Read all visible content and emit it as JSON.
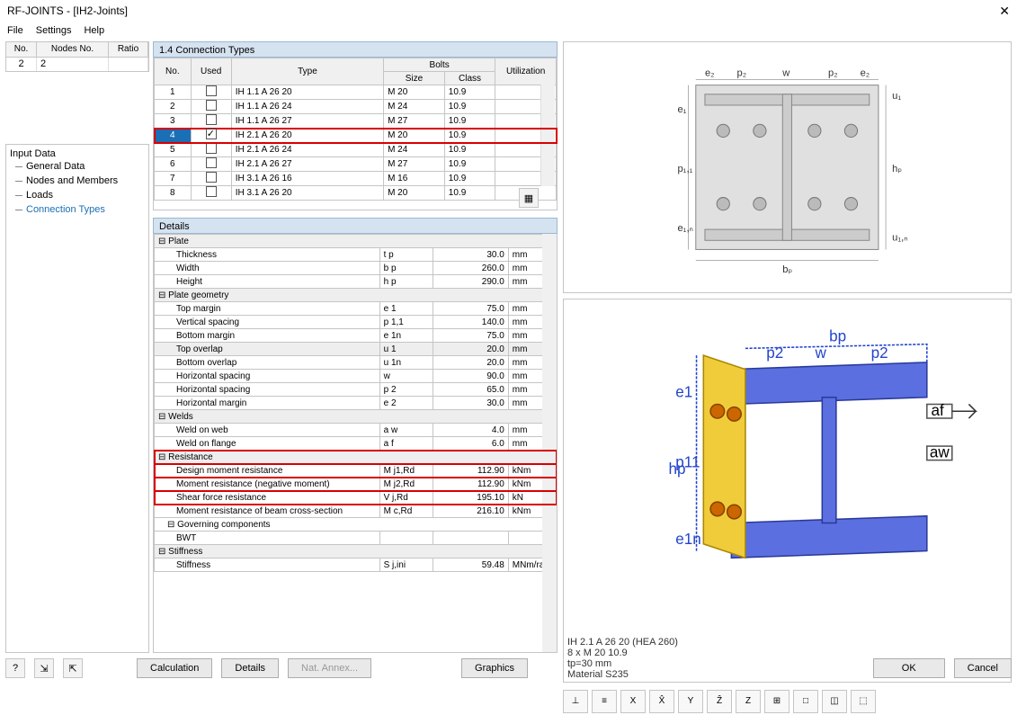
{
  "window": {
    "title": "RF-JOINTS - [IH2-Joints]"
  },
  "menu": {
    "file": "File",
    "settings": "Settings",
    "help": "Help"
  },
  "leftList": {
    "headers": {
      "no": "No.",
      "nodes": "Nodes No.",
      "ratio": "Ratio"
    },
    "row": {
      "no": "2",
      "nodes": "2",
      "ratio": ""
    }
  },
  "tree": {
    "root": "Input Data",
    "items": [
      "General Data",
      "Nodes and Members",
      "Loads",
      "Connection Types"
    ]
  },
  "panel": {
    "title": "1.4 Connection Types",
    "details_title": "Details"
  },
  "connHeaders": {
    "no": "No.",
    "used": "Used",
    "type": "Type",
    "bolts": "Bolts",
    "size": "Size",
    "class": "Class",
    "util": "Utilization"
  },
  "connRows": [
    {
      "no": "1",
      "used": false,
      "type": "IH 1.1 A 26 20",
      "size": "M 20",
      "class": "10.9"
    },
    {
      "no": "2",
      "used": false,
      "type": "IH 1.1 A 26 24",
      "size": "M 24",
      "class": "10.9"
    },
    {
      "no": "3",
      "used": false,
      "type": "IH 1.1 A 26 27",
      "size": "M 27",
      "class": "10.9"
    },
    {
      "no": "4",
      "used": true,
      "type": "IH 2.1 A 26 20",
      "size": "M 20",
      "class": "10.9",
      "sel": true,
      "hl": true
    },
    {
      "no": "5",
      "used": false,
      "type": "IH 2.1 A 26 24",
      "size": "M 24",
      "class": "10.9"
    },
    {
      "no": "6",
      "used": false,
      "type": "IH 2.1 A 26 27",
      "size": "M 27",
      "class": "10.9"
    },
    {
      "no": "7",
      "used": false,
      "type": "IH 3.1 A 26 16",
      "size": "M 16",
      "class": "10.9"
    },
    {
      "no": "8",
      "used": false,
      "type": "IH 3.1 A 26 20",
      "size": "M 20",
      "class": "10.9"
    }
  ],
  "details": [
    {
      "grp": "Plate"
    },
    {
      "label": "Thickness",
      "sym": "t p",
      "val": "30.0",
      "unit": "mm"
    },
    {
      "label": "Width",
      "sym": "b p",
      "val": "260.0",
      "unit": "mm"
    },
    {
      "label": "Height",
      "sym": "h p",
      "val": "290.0",
      "unit": "mm"
    },
    {
      "grp": "Plate geometry"
    },
    {
      "label": "Top margin",
      "sym": "e 1",
      "val": "75.0",
      "unit": "mm"
    },
    {
      "label": "Vertical spacing",
      "sym": "p 1,1",
      "val": "140.0",
      "unit": "mm"
    },
    {
      "label": "Bottom margin",
      "sym": "e 1n",
      "val": "75.0",
      "unit": "mm"
    },
    {
      "label": "Top overlap",
      "sym": "u 1",
      "val": "20.0",
      "unit": "mm",
      "shade": true
    },
    {
      "label": "Bottom overlap",
      "sym": "u 1n",
      "val": "20.0",
      "unit": "mm"
    },
    {
      "label": "Horizontal spacing",
      "sym": "w",
      "val": "90.0",
      "unit": "mm"
    },
    {
      "label": "Horizontal spacing",
      "sym": "p 2",
      "val": "65.0",
      "unit": "mm"
    },
    {
      "label": "Horizontal margin",
      "sym": "e 2",
      "val": "30.0",
      "unit": "mm"
    },
    {
      "grp": "Welds"
    },
    {
      "label": "Weld on web",
      "sym": "a w",
      "val": "4.0",
      "unit": "mm"
    },
    {
      "label": "Weld on flange",
      "sym": "a f",
      "val": "6.0",
      "unit": "mm"
    },
    {
      "grp": "Resistance",
      "hl": true
    },
    {
      "label": "Design moment resistance",
      "sym": "M j1,Rd",
      "val": "112.90",
      "unit": "kNm",
      "hl": true
    },
    {
      "label": "Moment resistance (negative moment)",
      "sym": "M j2,Rd",
      "val": "112.90",
      "unit": "kNm",
      "hl": true
    },
    {
      "label": "Shear force resistance",
      "sym": "V j,Rd",
      "val": "195.10",
      "unit": "kN"
    },
    {
      "label": "Moment resistance of beam cross-section",
      "sym": "M c,Rd",
      "val": "216.10",
      "unit": "kNm"
    },
    {
      "sub": "Governing components"
    },
    {
      "label": "BWT",
      "sym": "",
      "val": "",
      "unit": ""
    },
    {
      "grp": "Stiffness"
    },
    {
      "label": "Stiffness",
      "sym": "S j,ini",
      "val": "59.48",
      "unit": "MNm/ra"
    }
  ],
  "info": {
    "l1": "IH 2.1 A 26 20  (HEA 260)",
    "l2": "8 x M 20 10.9",
    "l3": "tp=30 mm",
    "l4": "Material S235"
  },
  "diagram_labels": {
    "e2": "e₂",
    "p2": "p₂",
    "w": "w",
    "e1": "e₁",
    "p11": "p₁,₁",
    "e1n": "e₁,ₙ",
    "u1": "u₁",
    "u1n": "u₁,ₙ",
    "hp": "hₚ",
    "bp": "bₚ"
  },
  "render_labels": {
    "bp": "bp",
    "p2": "p2",
    "w": "w",
    "e1": "e1",
    "p11": "p11",
    "hp": "hp",
    "e1n": "e1n",
    "af": "af",
    "aw": "aw"
  },
  "buttons": {
    "calc": "Calculation",
    "details": "Details",
    "nat": "Nat. Annex...",
    "graphics": "Graphics",
    "ok": "OK",
    "cancel": "Cancel"
  },
  "tool_icons": [
    "⊥",
    "≡",
    "X",
    "X̂",
    "Y",
    "Ẑ",
    "Z",
    "⊞",
    "□",
    "◫",
    "⬚"
  ]
}
